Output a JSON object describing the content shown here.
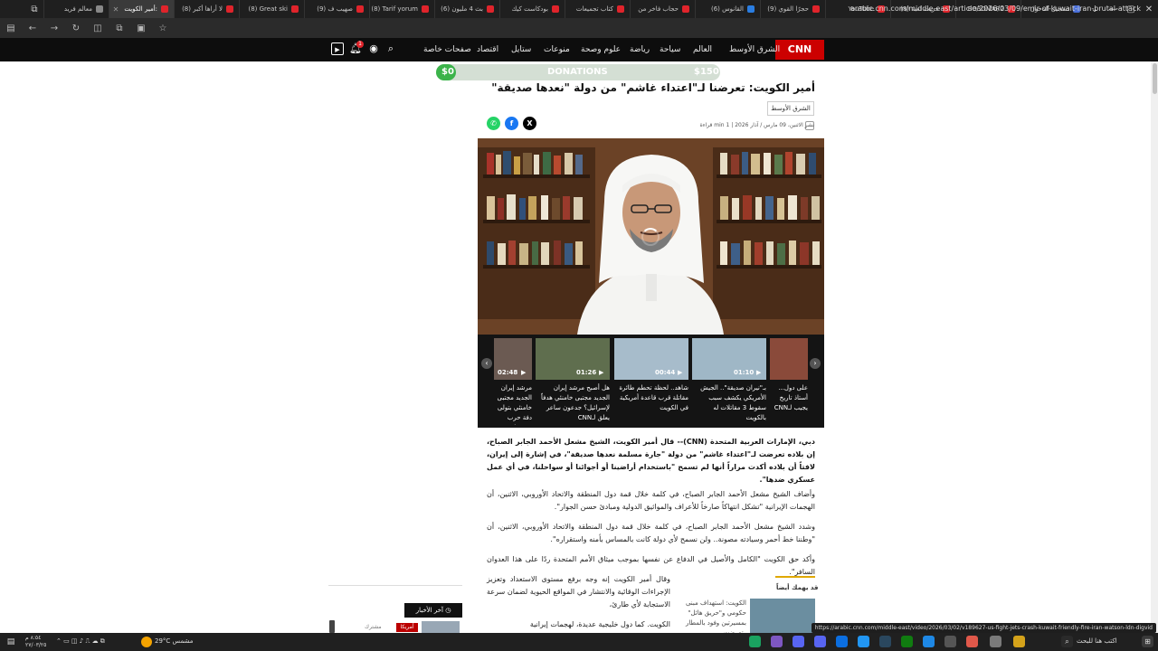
{
  "browser": {
    "tabs": [
      {
        "label": "تسجيل الدخول",
        "active": false
      },
      {
        "label": "BO3OMAR2",
        "active": false
      },
      {
        "label": "(8) حريت لعبة",
        "active": false
      },
      {
        "label": "YouTube",
        "active": false
      },
      {
        "label": "(9) حجرًا القوي",
        "active": false
      },
      {
        "label": "(6) القانوس",
        "active": false
      },
      {
        "label": "حجاب فاخر من",
        "active": false
      },
      {
        "label": "كتاب تجميعات",
        "active": false
      },
      {
        "label": "بودكاست كيك",
        "active": false
      },
      {
        "label": "(6) بث 4 مليون",
        "active": false
      },
      {
        "label": "(8) Tarif yorum",
        "active": false
      },
      {
        "label": "(9) صهيب ف",
        "active": false
      },
      {
        "label": "(8) Great ski",
        "active": false
      },
      {
        "label": "(8) لا أراها أكبر",
        "active": false
      },
      {
        "label": "أمير الكويت:",
        "active": true
      },
      {
        "label": "معالم فريد",
        "active": false
      }
    ],
    "url": "arabic.cnn.com/middle-east/article/2026/03/09/emir-of-kuwait-iran-brutal-attack",
    "status_url": "https://arabic.cnn.com/middle-east/video/2026/03/02/v189627-us-fight-jets-crash-kuwait-friendly-fire-iran-watson-ldn-digvid"
  },
  "site": {
    "logo": "CNN عربي",
    "nav": [
      "الشرق الأوسط",
      "العالم",
      "سياحة",
      "رياضة",
      "علوم وصحة",
      "منوعات",
      "ستايل",
      "اقتصاد",
      "صفحات خاصة"
    ],
    "notification_count": "1"
  },
  "donations": {
    "label": "DONATIONS",
    "current": "$0",
    "goal": "$150",
    "progress": 0
  },
  "article": {
    "headline": "أمير الكويت: تعرضنا لـ\"اعتداء غاشم\" من دولة \"نعدها صديقة\"",
    "section": "الشرق الأوسط",
    "meta": "نشر الاثنين، 09 مارس / آذار 2026  |  1 min قراءة",
    "paragraphs": [
      "دبي، الإمارات العربية المتحدة (CNN)-- قال أمير الكويت، الشيخ مشعل الأحمد الجابر الصباح، إن بلاده تعرضت لـ\"اعتداء غاشم\" من دولة \"جارة مسلمة نعدها صديقة\"، في إشارة إلى إيران، لافتاً أن بلاده أكدت مراراً أنها لم تسمح \"باستخدام أراضينا أو أجوائنا أو سواحلنا، في أي عمل عسكري ضدها\".",
      "وأضاف الشيخ مشعل الأحمد الجابر الصباح، في كلمة خلال قمة دول المنطقة والاتحاد الأوروبي، الاثنين، أن الهجمات الإيرانية \"تشكل انتهاكاً صارخاً للأعراف والمواثيق الدولية ومبادئ حسن الجوار\".",
      "وشدد الشيخ مشعل الأحمد الجابر الصباح، في كلمة خلال قمة دول المنطقة والاتحاد الأوروبي، الاثنين، أن \"وطننا خط أحمر وسيادته مصونة.. ولن نسمح لأي دولة كانت بالمساس بأمنه واستقراره\".",
      "وأكد حق الكويت \"الكامل والأصيل في الدفاع عن نفسها بموجب ميثاق الأمم المتحدة ردًا على هذا العدوان السافر\".",
      "وقال أمير الكويت إنه وجه برفع مستوى الاستعداد وتعزيز الإجراءات الوقائية والانتشار في المواقع الحيوية لضمان سرعة الاستجابة لأي طارئ،"
    ],
    "trailing": "الكويت. كما دول خليجية عديدة، لهجمات إيرانية",
    "read_also": "قد يهمك أيضاً",
    "related_title": "الكويت: استهداف مبنى حكومي و\"حريق هائل\" بمسيرتين وفود بالمطار وتعرضت",
    "latest_label": "آخر الأخبار",
    "sidebar_badge": "أمريكا",
    "sidebar_sub": "مشترك"
  },
  "video_carousel": [
    {
      "duration": "01:10",
      "caption": "بـ\"نيران صديقة\".. الجيش الأمريكي يكشف سبب سقوط 3 مقاتلات له بالكويت"
    },
    {
      "duration": "00:44",
      "caption": "شاهد.. لحظة تحطم طائرة مقاتلة قرب قاعدة أمريكية في الكويت"
    },
    {
      "duration": "01:26",
      "caption": "هل أصبح مرشد إيران الجديد مجتبى خامنئي هدفاً لإسرائيل؟ جدعون ساعر يعلق لـCNN"
    },
    {
      "duration": "02:48",
      "caption": "مرشد إيران الجديد مجتبى خامنئي بتولى دفة حرب وتهديدات.. إليكم ما نعرفه"
    },
    {
      "caption": "على دول... أستاذ تاريخ يجيب لـCNN"
    }
  ],
  "taskbar": {
    "search_placeholder": "اكتب هنا للبحث",
    "weather": "29°C مشمس",
    "clock_time": "٨:٥٤ م",
    "clock_date": "٢٧/٠٣/٢٥"
  },
  "colors": {
    "cnn_red": "#cc0000",
    "donation_green": "#3bb34a",
    "header_bg": "#0d0d0d"
  }
}
